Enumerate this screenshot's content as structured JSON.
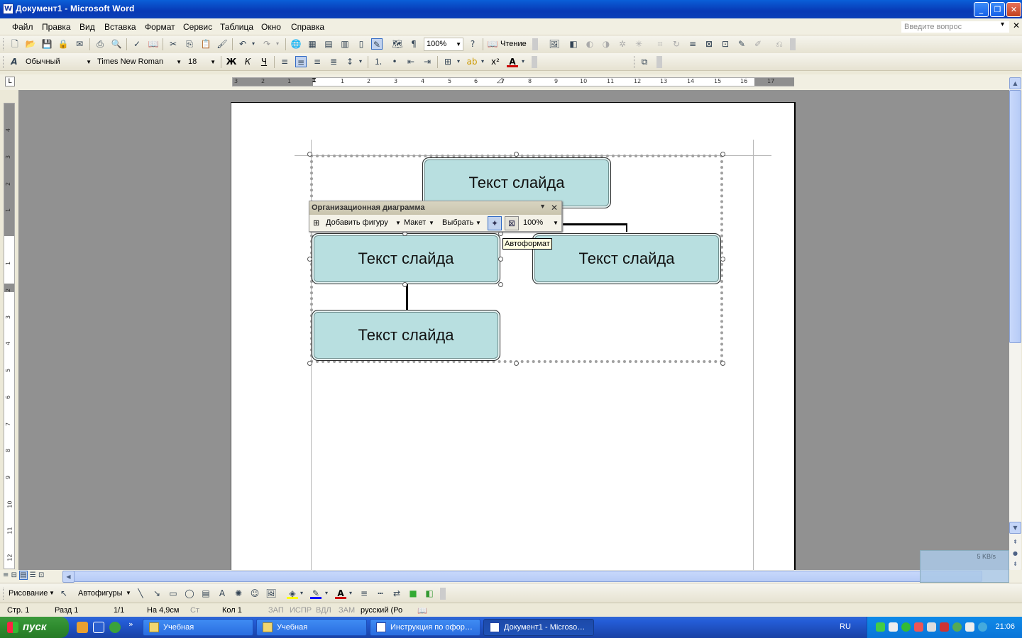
{
  "window": {
    "title": "Документ1 - Microsoft Word",
    "icon_letter": "W"
  },
  "window_controls": {
    "minimize": "_",
    "maximize": "❐",
    "close": "✕"
  },
  "menu": {
    "items": [
      "Файл",
      "Правка",
      "Вид",
      "Вставка",
      "Формат",
      "Сервис",
      "Таблица",
      "Окно",
      "Справка"
    ],
    "ask_placeholder": "Введите вопрос"
  },
  "standard_toolbar": {
    "zoom": "100%",
    "reading": "Чтение"
  },
  "format_toolbar": {
    "style": "Обычный",
    "font": "Times New Roman",
    "size": "18",
    "bold": "Ж",
    "italic": "К",
    "underline": "Ч"
  },
  "hruler": {
    "labels": [
      "3",
      "2",
      "1",
      "1",
      "2",
      "3",
      "4",
      "5",
      "6",
      "7",
      "8",
      "9",
      "10",
      "11",
      "12",
      "13",
      "14",
      "15",
      "16",
      "17"
    ]
  },
  "vruler": {
    "labels": [
      "4",
      "3",
      "2",
      "1",
      "1",
      "2",
      "3",
      "4",
      "5",
      "6",
      "7",
      "8",
      "9",
      "10",
      "11",
      "12"
    ]
  },
  "org_chart": {
    "nodes": [
      "Текст слайда",
      "Текст слайда",
      "Текст слайда",
      "Текст слайда"
    ]
  },
  "org_toolbar": {
    "title": "Организационная диаграмма",
    "add_shape": "Добавить фигуру",
    "layout": "Макет",
    "select": "Выбрать",
    "zoom": "100%"
  },
  "tooltip": "Автоформат",
  "net_widget": {
    "speed": "5 KB/s"
  },
  "drawing_toolbar": {
    "draw": "Рисование",
    "autoshapes": "Автофигуры"
  },
  "status": {
    "page": "Стр. 1",
    "section": "Разд 1",
    "pages": "1/1",
    "at": "На 4,9см",
    "line": "Ст",
    "col": "Кол 1",
    "rec": "ЗАП",
    "trk": "ИСПР",
    "ext": "ВДЛ",
    "ovr": "ЗАМ",
    "lang": "русский (Ро"
  },
  "taskbar": {
    "start": "пуск",
    "buttons": [
      "Учебная",
      "Учебная",
      "Инструкция по офор…",
      "Документ1 - Microso…"
    ],
    "lang": "RU",
    "clock": "21:06"
  }
}
